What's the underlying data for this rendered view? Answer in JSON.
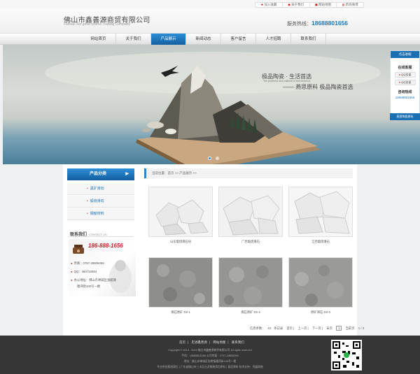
{
  "topbar": {
    "links": [
      {
        "icon": "star-icon",
        "label": "加入收藏"
      },
      {
        "icon": "user-icon",
        "label": "关于我们"
      },
      {
        "icon": "sitemap-icon",
        "label": "网站地图"
      },
      {
        "icon": "weibo-icon",
        "label": "新浪微博"
      }
    ]
  },
  "header": {
    "company": "佛山市鑫善源商贸有限公司",
    "company_en": "Foshan Xin good source Trading Company",
    "hotline_label": "服务热线：",
    "hotline_number": "18688801656"
  },
  "nav": {
    "items": [
      "网站首页",
      "关于我们",
      "产品展示",
      "新闻动态",
      "客户留言",
      "人才招聘",
      "联系我们"
    ],
    "active_index": 2
  },
  "banner": {
    "slogan1": "极品陶瓷 · 生活首选",
    "slogan_en": "The preferred new material of fine ceramics",
    "slogan2": "—— 燕思原料   极品陶瓷首选",
    "slides": 2,
    "active_slide": 0
  },
  "float": {
    "head": "点击收缩",
    "title": "在线客服",
    "qq1": "QQ交谈",
    "qq2": "QQ交谈",
    "tel_title": "咨询热线",
    "tel": "18688801656",
    "foot": "燕思陶瓷原料"
  },
  "sidebar": {
    "title": "产品分类",
    "items": [
      "黑矿滑石",
      "煅烧滑石",
      "钢窗材料"
    ],
    "contact_title": "联系我们",
    "contact_en": "CONTACT US",
    "contact_tel": "186-888-1656",
    "fax": "传真：0757-28806059",
    "qq": "QQ：360732684",
    "address1": "办公地址：佛山市禅城区张槎镇",
    "address2": "塘湾街100号一楼"
  },
  "crumb": "当前位置：首页 >> 产品展示 >>",
  "products": [
    {
      "name": "山东煅烧滑石块",
      "kind": "white"
    },
    {
      "name": "广西煅烧滑石",
      "kind": "white"
    },
    {
      "name": "江西煅烧滑石",
      "kind": "white"
    },
    {
      "name": "滑石原矿 D2-1",
      "kind": "grey"
    },
    {
      "name": "滑石原矿 D2-2",
      "kind": "grey"
    },
    {
      "name": "原矿滑石 D2-3",
      "kind": "grey"
    }
  ],
  "pager": {
    "total_label": "信息条数：",
    "total": "10",
    "unit": "条记录",
    "first": "首页",
    "prev": "上一页",
    "next": "下一页",
    "last": "末页",
    "page_select": "1",
    "goto": "当前页",
    "page_of": "1 / 3"
  },
  "footer": {
    "links": [
      "首页",
      "走进鑫善源",
      "网站地图",
      "联系我们"
    ],
    "copyright": "Copyright © 2013 - 2014 佛山市鑫善源商贸有限公司 All rights reserved",
    "contact": "手机：18688801656  公司传真：0757-28806059",
    "address": "地址：佛山市禅城区张槎镇塘湾街100号一楼",
    "keywords": "专业供应煅烧滑石 | 广东省佛山市三水区白泥煅烧滑石原料 | 瓷泥原料 技术支持：亮盛网络"
  },
  "colors": {
    "accent": "#1b6fb3",
    "hotline": "#1a7ac2",
    "contact_tel": "#c0262d",
    "footer_bg": "#363636"
  }
}
